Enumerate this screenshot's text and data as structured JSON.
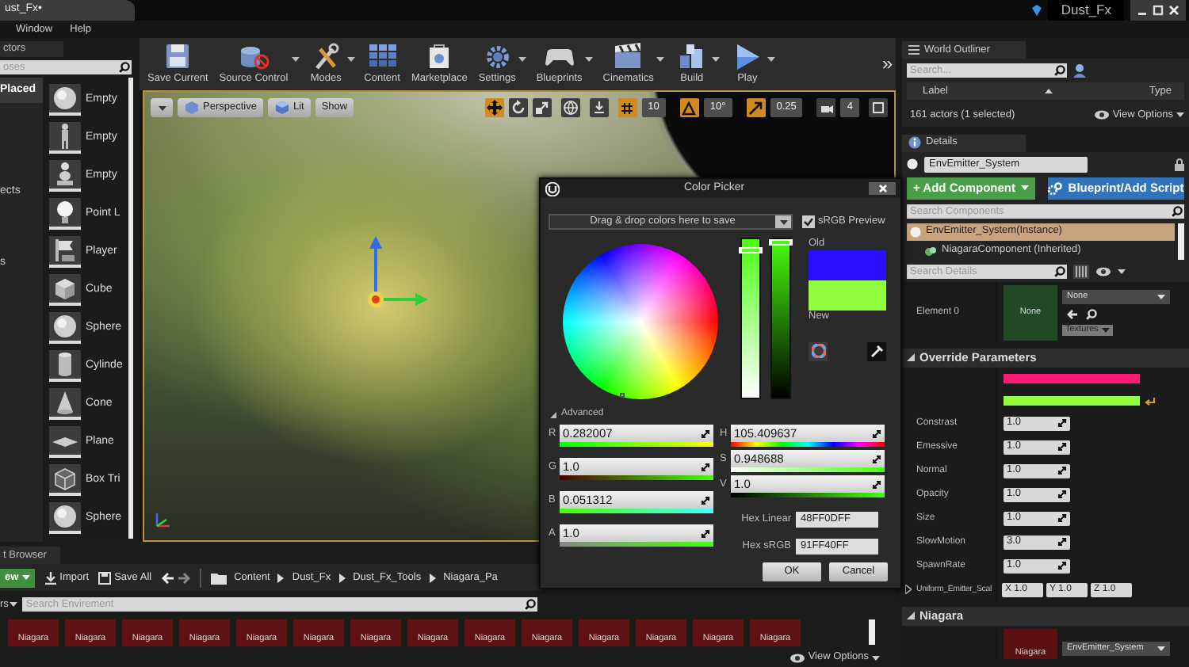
{
  "title_bar": {
    "document_tab": {
      "label": "ust_Fx•",
      "selected": true
    },
    "project_name": "Dust_Fx"
  },
  "menu_bar": [
    "Window",
    "Help"
  ],
  "place_actors": {
    "tab": "ctors",
    "search_placeholder": "oses",
    "categories": [
      {
        "label": "Placed",
        "selected": true
      },
      {
        "label": "ects",
        "selected": false
      },
      {
        "label": "s",
        "selected": false
      }
    ],
    "items": [
      {
        "label": "Empty",
        "kind": "sphere"
      },
      {
        "label": "Empty",
        "kind": "figure"
      },
      {
        "label": "Empty",
        "kind": "pawn"
      },
      {
        "label": "Point L",
        "kind": "bulb"
      },
      {
        "label": "Player",
        "kind": "flag"
      },
      {
        "label": "Cube",
        "kind": "cube"
      },
      {
        "label": "Sphere",
        "kind": "sphere"
      },
      {
        "label": "Cylinde",
        "kind": "cylinder"
      },
      {
        "label": "Cone",
        "kind": "cone"
      },
      {
        "label": "Plane",
        "kind": "plane"
      },
      {
        "label": "Box Tri",
        "kind": "box"
      },
      {
        "label": "Sphere",
        "kind": "sphere"
      }
    ]
  },
  "toolbar": {
    "buttons": [
      {
        "label": "Save Current",
        "kind": "save",
        "dropdown": false
      },
      {
        "label": "Source Control",
        "kind": "source",
        "dropdown": true
      },
      {
        "label": "Modes",
        "kind": "modes",
        "dropdown": true
      },
      {
        "label": "Content",
        "kind": "content",
        "dropdown": false
      },
      {
        "label": "Marketplace",
        "kind": "marketplace",
        "dropdown": false
      },
      {
        "label": "Settings",
        "kind": "settings",
        "dropdown": true
      },
      {
        "label": "Blueprints",
        "kind": "blueprints",
        "dropdown": true
      },
      {
        "label": "Cinematics",
        "kind": "cinematics",
        "dropdown": true
      },
      {
        "label": "Build",
        "kind": "build",
        "dropdown": true
      },
      {
        "label": "Play",
        "kind": "play",
        "dropdown": true
      }
    ],
    "overflow": "»"
  },
  "viewport": {
    "buttons": [
      {
        "label": "Perspective",
        "kind": "perspective"
      },
      {
        "label": "Lit",
        "kind": "lit"
      },
      {
        "label": "Show",
        "kind": "plain"
      }
    ],
    "snaps": [
      {
        "value": "10",
        "kind": "grid"
      },
      {
        "value": "10°",
        "kind": "rotate"
      },
      {
        "value": "0.25",
        "kind": "scale"
      },
      {
        "value": "4",
        "kind": "camera"
      }
    ]
  },
  "content_browser": {
    "tab": "t Browser",
    "new_button": "ew",
    "import": "Import",
    "save_all": "Save All",
    "path": [
      "Content",
      "Dust_Fx",
      "Dust_Fx_Tools",
      "Niagara_Pa"
    ],
    "filters": "rs",
    "search_placeholder": "Search Envirement",
    "assets": [
      "Niagara",
      "Niagara",
      "Niagara",
      "Niagara",
      "Niagara",
      "Niagara",
      "Niagara",
      "Niagara",
      "Niagara",
      "Niagara",
      "Niagara",
      "Niagara",
      "Niagara",
      "Niagara"
    ],
    "view_options": "View Options"
  },
  "world_outliner": {
    "tab": "World Outliner",
    "search_placeholder": "Search...",
    "columns": [
      "Label",
      "Type"
    ],
    "status": "161 actors (1 selected)",
    "view_options": "View Options"
  },
  "details": {
    "tab": "Details",
    "actor_name": "EnvEmitter_System",
    "add_component": "+ Add Component",
    "blueprint": "Blueprint/Add Script",
    "search_components_placeholder": "Search Components",
    "components": [
      {
        "label": "EnvEmitter_System(Instance)",
        "selected": true,
        "children": [
          {
            "label": "NiagaraComponent (Inherited)",
            "selected": false
          }
        ]
      }
    ],
    "search_details_placeholder": "Search Details",
    "element": {
      "label": "Element 0",
      "thumbnail": "None",
      "asset": "None",
      "filter": "Textures"
    },
    "override_parameters": {
      "title": "Override Parameters",
      "color_params": [
        {
          "color": "#ff1a75",
          "reset": false
        },
        {
          "color": "#91ff40",
          "reset": true
        }
      ],
      "params": [
        {
          "label": "Constrast",
          "value": "1.0"
        },
        {
          "label": "Emessive",
          "value": "1.0"
        },
        {
          "label": "Normal",
          "value": "1.0"
        },
        {
          "label": "Opacity",
          "value": "1.0"
        },
        {
          "label": "Size",
          "value": "1.0"
        },
        {
          "label": "SlowMotion",
          "value": "3.0"
        },
        {
          "label": "SpawnRate",
          "value": "1.0"
        }
      ],
      "vector_param": {
        "label": "Uniform_Emitter_Scal",
        "components": [
          {
            "axis": "X",
            "value": "1.0"
          },
          {
            "axis": "Y",
            "value": "1.0"
          },
          {
            "axis": "Z",
            "value": "1.0"
          }
        ]
      }
    },
    "niagara": {
      "title": "Niagara",
      "thumbnail": "Niagara",
      "asset": "EnvEmitter_System"
    }
  },
  "color_picker": {
    "title": "Color Picker",
    "themes_placeholder": "Drag & drop colors here to save",
    "srgb_preview": {
      "label": "sRGB Preview",
      "checked": true
    },
    "sliders": [
      {
        "kind": "saturation",
        "level": 0.95
      },
      {
        "kind": "value",
        "level": 1.0
      }
    ],
    "swatches": [
      {
        "label": "Old",
        "color": "#2a10ff"
      },
      {
        "label": "New",
        "color": "#91ff40"
      }
    ],
    "advanced": "Advanced",
    "rgba": [
      {
        "label": "R",
        "value": "0.282007"
      },
      {
        "label": "G",
        "value": "1.0"
      },
      {
        "label": "B",
        "value": "0.051312"
      },
      {
        "label": "A",
        "value": "1.0"
      }
    ],
    "hsv": [
      {
        "label": "H",
        "value": "105.409637"
      },
      {
        "label": "S",
        "value": "0.948688"
      },
      {
        "label": "V",
        "value": "1.0"
      }
    ],
    "hex": [
      {
        "label": "Hex Linear",
        "value": "48FF0DFF"
      },
      {
        "label": "Hex sRGB",
        "value": "91FF40FF"
      }
    ],
    "buttons": [
      "OK",
      "Cancel"
    ]
  }
}
